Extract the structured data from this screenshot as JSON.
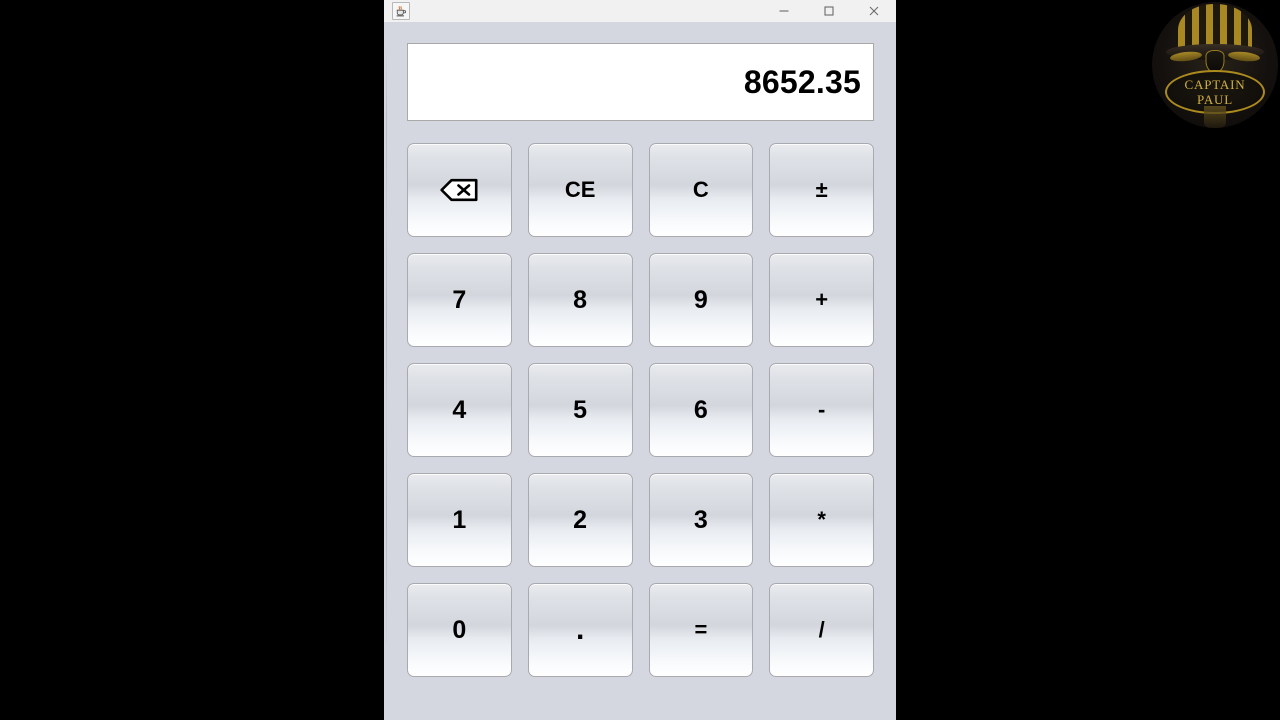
{
  "window": {
    "title": "",
    "app_icon": "java-coffee-cup-icon",
    "controls": [
      {
        "name": "minimize",
        "glyph": "minimize-icon"
      },
      {
        "name": "maximize",
        "glyph": "maximize-icon"
      },
      {
        "name": "close",
        "glyph": "close-icon"
      }
    ]
  },
  "display": {
    "value": "8652.35"
  },
  "keypad": {
    "rows": [
      [
        {
          "label": "⌫",
          "name": "backspace",
          "kind": "icon"
        },
        {
          "label": "CE",
          "name": "clear-entry",
          "kind": "op"
        },
        {
          "label": "C",
          "name": "clear",
          "kind": "op"
        },
        {
          "label": "±",
          "name": "sign-toggle",
          "kind": "op"
        }
      ],
      [
        {
          "label": "7",
          "name": "digit-7",
          "kind": "digit"
        },
        {
          "label": "8",
          "name": "digit-8",
          "kind": "digit"
        },
        {
          "label": "9",
          "name": "digit-9",
          "kind": "digit"
        },
        {
          "label": "+",
          "name": "add",
          "kind": "op"
        }
      ],
      [
        {
          "label": "4",
          "name": "digit-4",
          "kind": "digit"
        },
        {
          "label": "5",
          "name": "digit-5",
          "kind": "digit"
        },
        {
          "label": "6",
          "name": "digit-6",
          "kind": "digit"
        },
        {
          "label": "-",
          "name": "subtract",
          "kind": "op"
        }
      ],
      [
        {
          "label": "1",
          "name": "digit-1",
          "kind": "digit"
        },
        {
          "label": "2",
          "name": "digit-2",
          "kind": "digit"
        },
        {
          "label": "3",
          "name": "digit-3",
          "kind": "digit"
        },
        {
          "label": "*",
          "name": "multiply",
          "kind": "op"
        }
      ],
      [
        {
          "label": "0",
          "name": "digit-0",
          "kind": "digit"
        },
        {
          "label": ".",
          "name": "decimal-point",
          "kind": "dot"
        },
        {
          "label": "=",
          "name": "equals",
          "kind": "op"
        },
        {
          "label": "/",
          "name": "divide",
          "kind": "op"
        }
      ]
    ]
  },
  "watermark": {
    "line1": "CAPTAIN",
    "line2": "PAUL"
  },
  "colors": {
    "desktop": "#000000",
    "window_bg": "#d4d7df",
    "titlebar": "#f1f1f1",
    "display_bg": "#ffffff",
    "key_border": "#a8aab0",
    "text": "#000000",
    "logo_gold": "#d6b547"
  }
}
